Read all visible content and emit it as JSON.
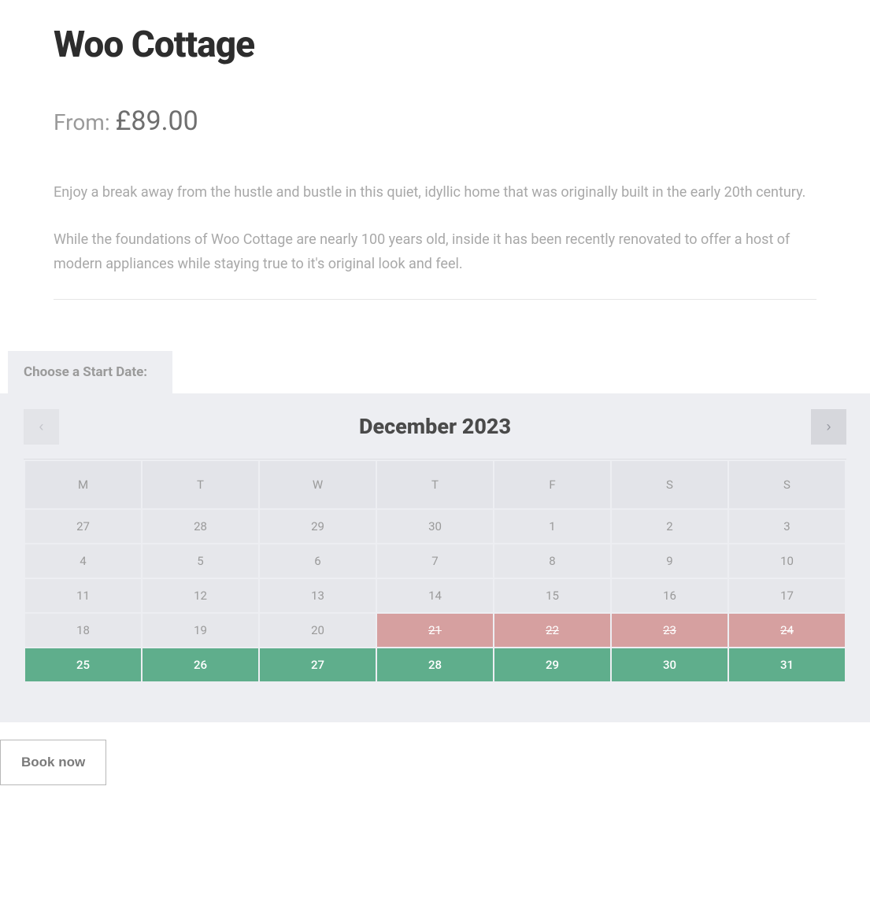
{
  "title": "Woo Cottage",
  "price": {
    "prefix": "From: ",
    "currency": "£",
    "amount": "89.00"
  },
  "description": {
    "p1": "Enjoy a break away from the hustle and bustle in this quiet, idyllic home that was originally built in the early 20th century.",
    "p2": "While the foundations of Woo Cottage are nearly 100 years old, inside it has been recently renovated to offer a host of modern appliances while staying true to it's original look and feel."
  },
  "calendar": {
    "tab_label": "Choose a Start Date:",
    "month_label": "December 2023",
    "weekdays": [
      "M",
      "T",
      "W",
      "T",
      "F",
      "S",
      "S"
    ],
    "weeks": [
      [
        {
          "d": "27",
          "s": "past"
        },
        {
          "d": "28",
          "s": "past"
        },
        {
          "d": "29",
          "s": "past"
        },
        {
          "d": "30",
          "s": "past"
        },
        {
          "d": "1",
          "s": "past"
        },
        {
          "d": "2",
          "s": "past"
        },
        {
          "d": "3",
          "s": "past"
        }
      ],
      [
        {
          "d": "4",
          "s": "past"
        },
        {
          "d": "5",
          "s": "past"
        },
        {
          "d": "6",
          "s": "past"
        },
        {
          "d": "7",
          "s": "past"
        },
        {
          "d": "8",
          "s": "past"
        },
        {
          "d": "9",
          "s": "past"
        },
        {
          "d": "10",
          "s": "past"
        }
      ],
      [
        {
          "d": "11",
          "s": "past"
        },
        {
          "d": "12",
          "s": "past"
        },
        {
          "d": "13",
          "s": "past"
        },
        {
          "d": "14",
          "s": "past"
        },
        {
          "d": "15",
          "s": "past"
        },
        {
          "d": "16",
          "s": "past"
        },
        {
          "d": "17",
          "s": "past"
        }
      ],
      [
        {
          "d": "18",
          "s": "past"
        },
        {
          "d": "19",
          "s": "past"
        },
        {
          "d": "20",
          "s": "past"
        },
        {
          "d": "21",
          "s": "unavail"
        },
        {
          "d": "22",
          "s": "unavail"
        },
        {
          "d": "23",
          "s": "unavail"
        },
        {
          "d": "24",
          "s": "unavail"
        }
      ],
      [
        {
          "d": "25",
          "s": "avail"
        },
        {
          "d": "26",
          "s": "avail"
        },
        {
          "d": "27",
          "s": "avail"
        },
        {
          "d": "28",
          "s": "avail"
        },
        {
          "d": "29",
          "s": "avail"
        },
        {
          "d": "30",
          "s": "avail"
        },
        {
          "d": "31",
          "s": "avail"
        }
      ]
    ]
  },
  "book_button": "Book now"
}
